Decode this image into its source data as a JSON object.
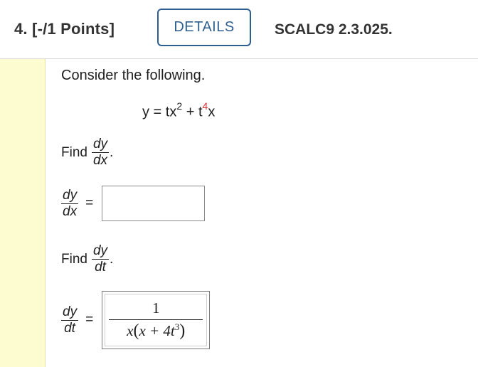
{
  "header": {
    "question_label": "4.  [-/1 Points]",
    "details_label": "DETAILS",
    "source": "SCALC9 2.3.025."
  },
  "problem": {
    "prompt": "Consider the following.",
    "equation_prefix": "y = tx",
    "equation_exp1": "2",
    "equation_mid": " + t",
    "equation_exp2": "4",
    "equation_suffix": "x"
  },
  "part1": {
    "find_label": "Find",
    "frac_num": "dy",
    "frac_den": "dx",
    "answer_value": ""
  },
  "part2": {
    "find_label": "Find",
    "frac_num": "dy",
    "frac_den": "dt",
    "answer_numerator": "1",
    "answer_den_x1": "x",
    "answer_den_inner": "x + 4t",
    "answer_den_exp": "3"
  },
  "colors": {
    "accent": "#2f5f8f",
    "highlight_bar": "#fdfbd0",
    "exponent_red": "#dd3333"
  }
}
